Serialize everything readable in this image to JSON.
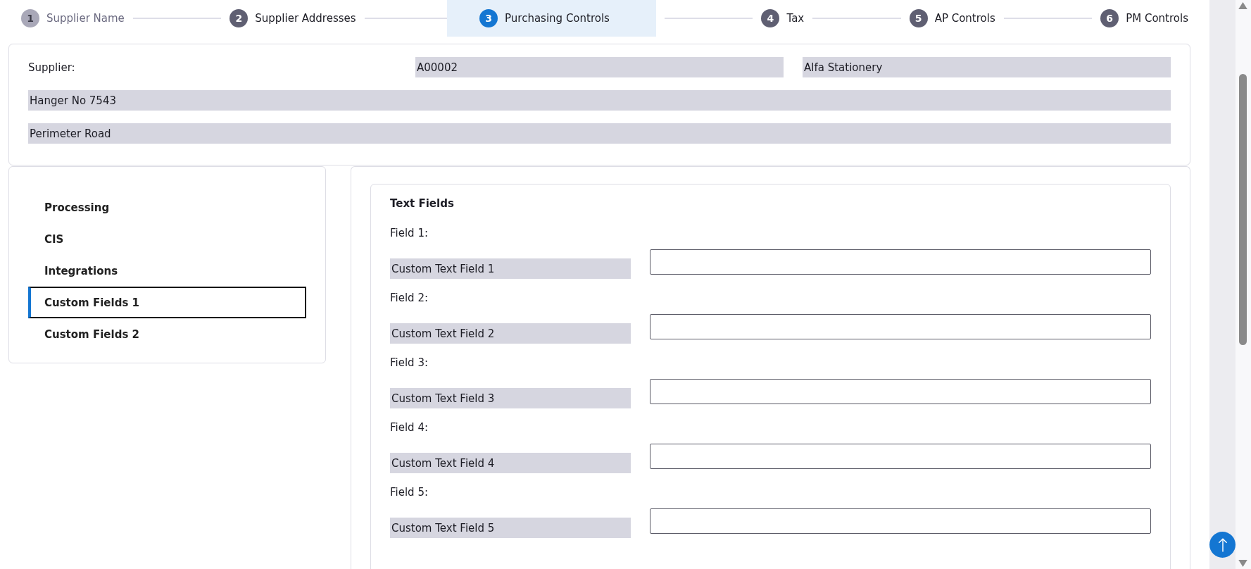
{
  "stepper": [
    {
      "number": "1",
      "label": "Supplier Name",
      "selected": false,
      "visited": true
    },
    {
      "number": "2",
      "label": "Supplier Addresses",
      "selected": false,
      "visited": false
    },
    {
      "number": "3",
      "label": "Purchasing Controls",
      "selected": true,
      "visited": false
    },
    {
      "number": "4",
      "label": "Tax",
      "selected": false,
      "visited": false
    },
    {
      "number": "5",
      "label": "AP Controls",
      "selected": false,
      "visited": false
    },
    {
      "number": "6",
      "label": "PM Controls",
      "selected": false,
      "visited": false
    }
  ],
  "supplier": {
    "label": "Supplier:",
    "code": "A00002",
    "name": "Alfa Stationery",
    "address_lines": [
      "Hanger No 7543",
      "Perimeter Road"
    ]
  },
  "nav": [
    {
      "label": "Processing",
      "selected": false
    },
    {
      "label": "CIS",
      "selected": false
    },
    {
      "label": "Integrations",
      "selected": false
    },
    {
      "label": "Custom Fields 1",
      "selected": true
    },
    {
      "label": "Custom Fields 2",
      "selected": false
    }
  ],
  "text_fields": {
    "title": "Text Fields",
    "fields": [
      {
        "label": "Field 1:",
        "name": "Custom Text Field 1"
      },
      {
        "label": "Field 2:",
        "name": "Custom Text Field 2"
      },
      {
        "label": "Field 3:",
        "name": "Custom Text Field 3"
      },
      {
        "label": "Field 4:",
        "name": "Custom Text Field 4"
      },
      {
        "label": "Field 5:",
        "name": "Custom Text Field 5"
      }
    ]
  }
}
